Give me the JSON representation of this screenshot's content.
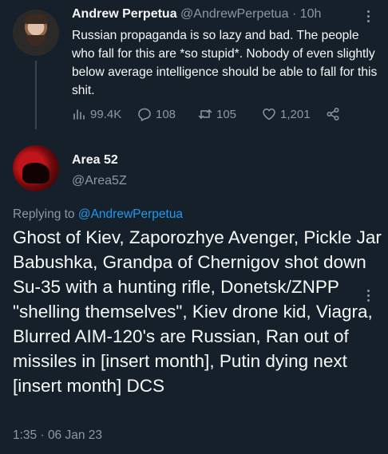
{
  "parent_tweet": {
    "author_name": "Andrew Perpetua",
    "author_handle": "@AndrewPerpetua",
    "separator": "·",
    "age": "10h",
    "text": "Russian propaganda is so lazy and bad. The people who fall for this are *so stupid*. Nobody of even slightly below average intelligence should be able to fall for this shit.",
    "views": "99.4K",
    "replies": "108",
    "retweets": "105",
    "likes": "1,201"
  },
  "reply_tweet": {
    "author_name": "Area 52",
    "author_handle": "@Area5Z",
    "replying_prefix": "Replying to ",
    "replying_to": "@AndrewPerpetua",
    "text": "Ghost of Kiev, Zaporozhye Avenger, Pickle Jar Babushka, Grandpa of Chernigov shot down Su-35 with a hunting rifle, Donetsk/ZNPP \"shelling themselves\", Kiev drone kid, Viagra, Blurred AIM-120's are Russian, Ran out of missiles in [insert month], Putin dying next [insert month] DCS",
    "timestamp": "1:35 · 06 Jan 23"
  },
  "colors": {
    "background": "#15202b",
    "text": "#f7f9f9",
    "muted": "#8b98a5",
    "link": "#1d9bf0"
  }
}
